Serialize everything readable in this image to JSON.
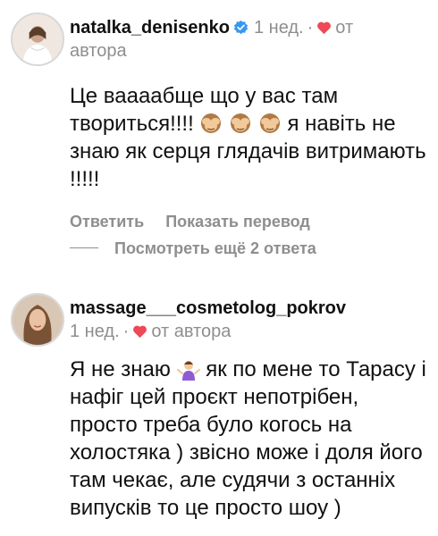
{
  "comments": [
    {
      "username": "natalka_denisenko",
      "verified": true,
      "time": "1 нед.",
      "dot": "·",
      "author_like": "от",
      "author_like_line2": "автора",
      "text_parts": [
        "Це ваааабще що у вас там творитьсяǃǃǃǃ",
        "я навіть не знаю як серця глядачів витримають !!!!!"
      ],
      "emoji": "see-no-evil-monkey",
      "actions": {
        "reply": "Ответить",
        "translate": "Показать перевод"
      }
    },
    {
      "username": "massage___cosmetolog_pokrov",
      "verified": false,
      "time": "1 нед.",
      "dot": "·",
      "author_like": "от автора",
      "text_parts": [
        "Я не знаю",
        "як по мене то Тарасу і нафіг цей проєкт непотрібен, просто треба було когось на холостяка ) звісно може і доля його там чекає, але судячи з останніх випусків то це просто шоу )"
      ],
      "emoji": "woman-shrugging"
    }
  ],
  "view_replies": "Посмотреть ещё 2 ответа",
  "colors": {
    "heart": "#ed4956",
    "verified": "#3897f0",
    "muted": "#8e8e8e",
    "text": "#111111"
  }
}
